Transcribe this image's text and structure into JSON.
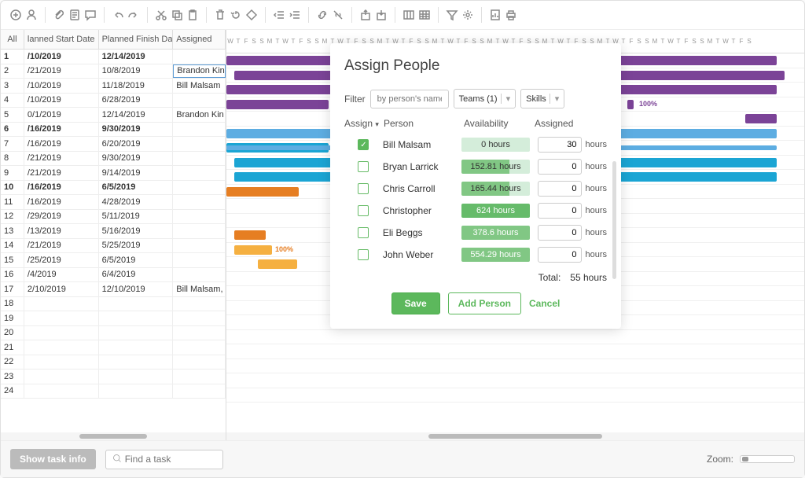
{
  "toolbar_icons": [
    "plus",
    "person",
    "clip",
    "doc",
    "chat",
    "undo",
    "redo",
    "cut",
    "copy",
    "paste",
    "trash",
    "back",
    "diamond",
    "indent-l",
    "indent-r",
    "link",
    "unlink",
    "export",
    "import",
    "table",
    "grid",
    "filter",
    "gear",
    "page",
    "print"
  ],
  "grid": {
    "headers": {
      "all": "All",
      "start": "lanned Start Date",
      "finish": "Planned Finish Date",
      "assigned": "Assigned"
    },
    "rows": [
      {
        "n": "1",
        "start": "/10/2019",
        "finish": "12/14/2019",
        "ass": "",
        "bold": true
      },
      {
        "n": "2",
        "start": "/21/2019",
        "finish": "10/8/2019",
        "ass": "Brandon Kinn",
        "sel": true
      },
      {
        "n": "3",
        "start": "/10/2019",
        "finish": "11/18/2019",
        "ass": "Bill Malsam"
      },
      {
        "n": "4",
        "start": "/10/2019",
        "finish": "6/28/2019",
        "ass": ""
      },
      {
        "n": "5",
        "start": "0/1/2019",
        "finish": "12/14/2019",
        "ass": "Brandon Kin"
      },
      {
        "n": "6",
        "start": "/16/2019",
        "finish": "9/30/2019",
        "ass": "",
        "bold": true
      },
      {
        "n": "7",
        "start": "/16/2019",
        "finish": "6/20/2019",
        "ass": ""
      },
      {
        "n": "8",
        "start": "/21/2019",
        "finish": "9/30/2019",
        "ass": ""
      },
      {
        "n": "9",
        "start": "/21/2019",
        "finish": "9/14/2019",
        "ass": ""
      },
      {
        "n": "10",
        "start": "/16/2019",
        "finish": "6/5/2019",
        "ass": "",
        "bold": true
      },
      {
        "n": "11",
        "start": "/16/2019",
        "finish": "4/28/2019",
        "ass": ""
      },
      {
        "n": "12",
        "start": "/29/2019",
        "finish": "5/11/2019",
        "ass": ""
      },
      {
        "n": "13",
        "start": "/13/2019",
        "finish": "5/16/2019",
        "ass": ""
      },
      {
        "n": "14",
        "start": "/21/2019",
        "finish": "5/25/2019",
        "ass": ""
      },
      {
        "n": "15",
        "start": "/25/2019",
        "finish": "6/5/2019",
        "ass": ""
      },
      {
        "n": "16",
        "start": "/4/2019",
        "finish": "6/4/2019",
        "ass": ""
      },
      {
        "n": "17",
        "start": "2/10/2019",
        "finish": "12/10/2019",
        "ass": "Bill Malsam,"
      },
      {
        "n": "18",
        "start": "",
        "finish": "",
        "ass": ""
      },
      {
        "n": "19",
        "start": "",
        "finish": "",
        "ass": ""
      },
      {
        "n": "20",
        "start": "",
        "finish": "",
        "ass": ""
      },
      {
        "n": "21",
        "start": "",
        "finish": "",
        "ass": ""
      },
      {
        "n": "22",
        "start": "",
        "finish": "",
        "ass": ""
      },
      {
        "n": "23",
        "start": "",
        "finish": "",
        "ass": ""
      },
      {
        "n": "24",
        "start": "",
        "finish": "",
        "ass": ""
      }
    ]
  },
  "gantt": {
    "days": [
      "W",
      "T",
      "F",
      "S",
      "S",
      "M",
      "T",
      "W",
      "T",
      "F",
      "S",
      "S",
      "M",
      "T",
      "W",
      "T",
      "F",
      "S",
      "S",
      "M",
      "T",
      "W",
      "T",
      "F",
      "S",
      "S",
      "M",
      "T",
      "W",
      "T",
      "F",
      "S",
      "S",
      "M",
      "T",
      "W",
      "T",
      "F",
      "S",
      "S",
      "M",
      "T",
      "W",
      "T",
      "F",
      "S",
      "S",
      "M",
      "T",
      "W",
      "T",
      "F",
      "S",
      "S",
      "M",
      "T",
      "W",
      "T",
      "F",
      "S",
      "S",
      "M",
      "T",
      "W",
      "T",
      "F",
      "S"
    ],
    "label_100_a": "100%",
    "label_100_b": "100%"
  },
  "dialog": {
    "title": "Assign People",
    "filter_label": "Filter",
    "filter_placeholder": "by person's name",
    "teams_label": "Teams (1)",
    "skills_label": "Skills",
    "col_assign": "Assign",
    "col_person": "Person",
    "col_avail": "Availability",
    "col_assigned": "Assigned",
    "people": [
      {
        "name": "Bill Malsam",
        "avail": "0 hours",
        "assigned": "30",
        "checked": true,
        "cls": ""
      },
      {
        "name": "Bryan Larrick",
        "avail": "152.81 hours",
        "assigned": "0",
        "cls": "mid"
      },
      {
        "name": "Chris Carroll",
        "avail": "165.44 hours",
        "assigned": "0",
        "cls": "mid"
      },
      {
        "name": "Christopher",
        "avail": "624 hours",
        "assigned": "0",
        "cls": "full"
      },
      {
        "name": "Eli Beggs",
        "avail": "378.6 hours",
        "assigned": "0",
        "cls": "high"
      },
      {
        "name": "John Weber",
        "avail": "554.29 hours",
        "assigned": "0",
        "cls": "high"
      }
    ],
    "unit": "hours",
    "total_label": "Total:",
    "total_value": "55 hours",
    "save": "Save",
    "add": "Add Person",
    "cancel": "Cancel"
  },
  "bottom": {
    "show_info": "Show task info",
    "find_placeholder": "Find a task",
    "zoom": "Zoom:"
  }
}
